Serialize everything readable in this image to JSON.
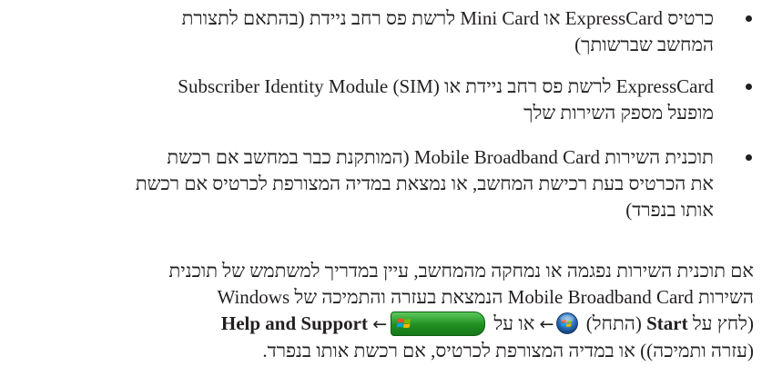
{
  "bullets": [
    {
      "lines": [
        "כרטיס ExpressCard או Mini Card לרשת פס רחב ניידת (בהתאם לתצורת",
        "המחשב שברשותך)"
      ]
    },
    {
      "lines": [
        "ExpressCard לרשת פס רחב ניידת או Subscriber Identity Module (SIM)",
        "מופעל מספק השירות שלך"
      ]
    },
    {
      "lines": [
        "תוכנית השירות Mobile Broadband Card (המותקנת כבר במחשב אם רכשת",
        "את הכרטיס בעת רכישת המחשב, או נמצאת במדיה המצורפת לכרטיס אם רכשת",
        "אותו בנפרד)"
      ]
    }
  ],
  "paragraph": {
    "line1": "אם תוכנית השירות נפגמה או נמחקה מהמחשב, עיין במדריך למשתמש של תוכנית",
    "line2": "השירות Mobile Broadband Card הנמצאת בעזרה והתמיכה של Windows",
    "start_prefix": "(לחץ על ",
    "start_bold": "Start",
    "start_hebrew": " (התחל) ",
    "arrow1": "←",
    "or_on": " או על ",
    "arrow2": "←",
    "help_bold": "Help and Support",
    "line4": "(עזרה ותמיכה)) או במדיה המצורפת לכרטיס, אם רכשת אותו בנפרד."
  },
  "icons": {
    "start_button": "windows-xp-start-button-icon",
    "start_orb": "windows-vista-start-orb-icon"
  },
  "colors": {
    "text": "#231f20",
    "start_button_green": "#1f8f22"
  }
}
